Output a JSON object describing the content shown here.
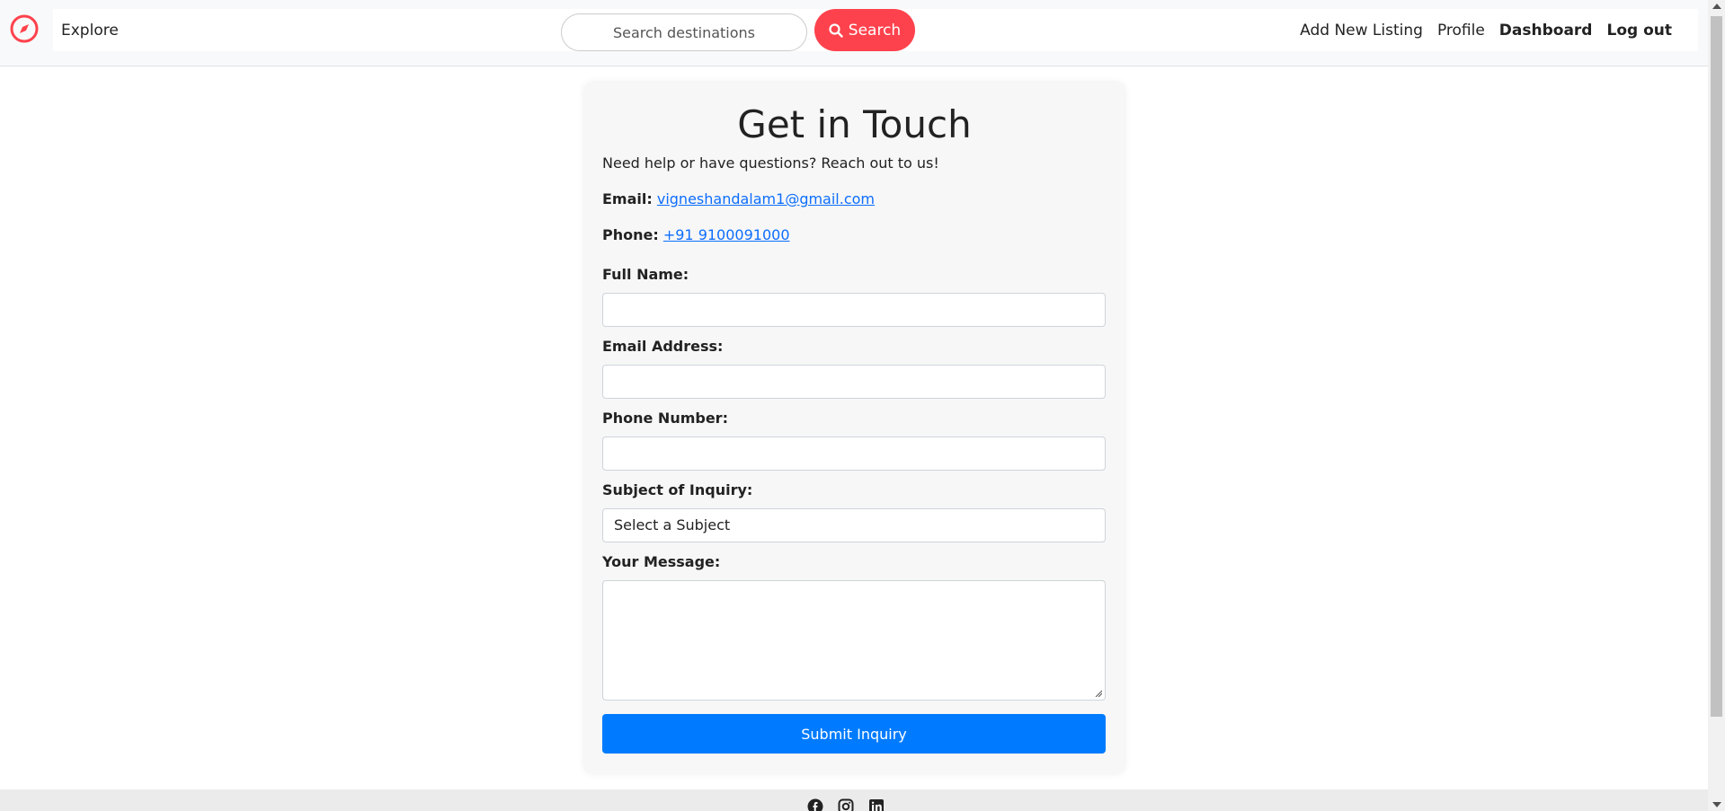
{
  "colors": {
    "brand": "#fe424d",
    "primary": "#007bff",
    "link": "#0d6efd"
  },
  "nav": {
    "logo_icon": "compass-icon",
    "explore": "Explore",
    "search_placeholder": "Search destinations",
    "search_label": "Search",
    "links": [
      "Add New Listing",
      "Profile",
      "Dashboard",
      "Log out"
    ]
  },
  "contact": {
    "title": "Get in Touch",
    "intro": "Need help or have questions? Reach out to us!",
    "email_label": "Email:",
    "email_value": "vigneshandalam1@gmail.com",
    "phone_label": "Phone:",
    "phone_value": "+91 9100091000"
  },
  "form": {
    "full_name_label": "Full Name:",
    "email_label": "Email Address:",
    "phone_label": "Phone Number:",
    "subject_label": "Subject of Inquiry:",
    "subject_selected": "Select a Subject",
    "message_label": "Your Message:",
    "submit_label": "Submit Inquiry"
  },
  "footer": {
    "icons": [
      "facebook-icon",
      "instagram-icon",
      "linkedin-icon"
    ]
  }
}
